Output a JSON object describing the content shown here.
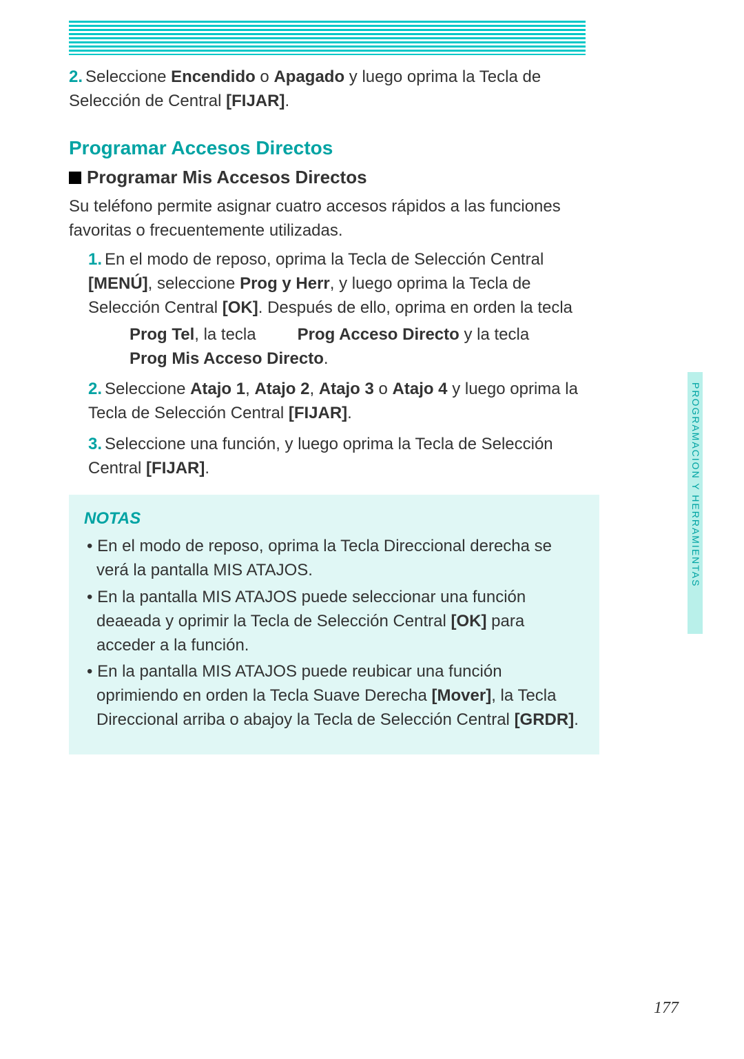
{
  "intro_step_num": "2.",
  "intro_step_a": "Seleccione ",
  "intro_step_b1": "Encendido",
  "intro_step_b2": " o ",
  "intro_step_b3": "Apagado",
  "intro_step_c": " y luego oprima la Tecla de Selección de Central ",
  "intro_step_d": "[FIJAR]",
  "intro_step_e": ".",
  "h1": "Programar Accesos Directos",
  "h2": "Programar Mis Accesos Directos",
  "desc": "Su teléfono permite asignar cuatro accesos rápidos a las funciones favoritas o frecuentemente utilizadas.",
  "s1_num": "1.",
  "s1_a": "En el modo de reposo, oprima la Tecla de Selección Central ",
  "s1_b": "[MENÚ]",
  "s1_c": ", seleccione ",
  "s1_d": "Prog y Herr",
  "s1_e": ", y luego oprima la Tecla de Selección Central ",
  "s1_f": "[OK]",
  "s1_g": ". Después de ello, oprima en orden la tecla",
  "s1_h": "Prog Tel",
  "s1_i": ", la tecla ",
  "s1_j": "Prog Acceso Directo",
  "s1_k": " y la tecla ",
  "s1_l": "Prog Mis Acceso Directo",
  "s1_m": ".",
  "s2_num": "2.",
  "s2_a": "Seleccione ",
  "s2_b": "Atajo 1",
  "s2_c": ", ",
  "s2_d": "Atajo 2",
  "s2_e": ", ",
  "s2_f": "Atajo 3",
  "s2_g": " o ",
  "s2_h": "Atajo 4",
  "s2_i": " y luego oprima la Tecla de Selección Central ",
  "s2_j": "[FIJAR]",
  "s2_k": ".",
  "s3_num": "3.",
  "s3_a": "Seleccione una función, y luego oprima la Tecla de Selección Central ",
  "s3_b": "[FIJAR]",
  "s3_c": ".",
  "notes_title": "NOTAS",
  "n1": "En el modo de reposo, oprima la Tecla Direccional       derecha se verá la pantalla MIS ATAJOS.",
  "n2_a": "En la pantalla MIS ATAJOS puede seleccionar una función deaeada y oprimir la Tecla de Selección Central ",
  "n2_b": "[OK]",
  "n2_c": " para acceder a la función.",
  "n3_a": "En la pantalla MIS ATAJOS puede reubicar una función oprimiendo en orden la Tecla Suave Derecha ",
  "n3_b": "[Mover]",
  "n3_c": ", la Tecla Direccional       arriba o abajoy la Tecla de Selección Central ",
  "n3_d": "[GRDR]",
  "n3_e": ".",
  "side": "PROGRAMACION Y HERRAMIENTAS",
  "page": "177"
}
